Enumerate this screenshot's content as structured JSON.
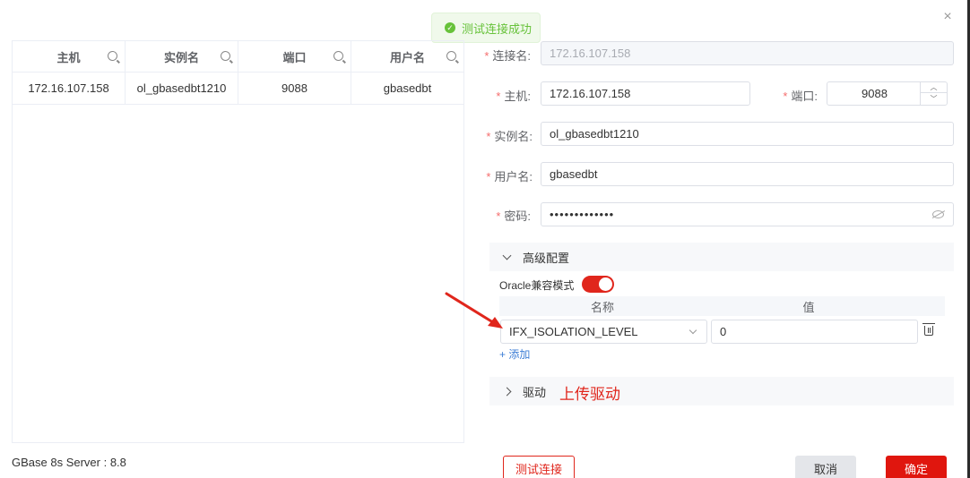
{
  "toast": {
    "message": "测试连接成功"
  },
  "table": {
    "columns": [
      "主机",
      "实例名",
      "端口",
      "用户名"
    ],
    "rows": [
      [
        "172.16.107.158",
        "ol_gbasedbt1210",
        "9088",
        "gbasedbt"
      ]
    ]
  },
  "footer": {
    "version": "GBase 8s Server : 8.8"
  },
  "form": {
    "conn_name_label": "连接名:",
    "conn_name_value": "172.16.107.158",
    "host_label": "主机:",
    "host_value": "172.16.107.158",
    "port_label": "端口:",
    "port_value": "9088",
    "instance_label": "实例名:",
    "instance_value": "ol_gbasedbt1210",
    "user_label": "用户名:",
    "user_value": "gbasedbt",
    "password_label": "密码:",
    "password_value": "•••••••••••••"
  },
  "advanced": {
    "title": "高级配置",
    "oracle_mode_label": "Oracle兼容模式",
    "oracle_mode_on": true,
    "col_name": "名称",
    "col_value": "值",
    "param_name": "IFX_ISOLATION_LEVEL",
    "param_value": "0",
    "add_label": "+ 添加"
  },
  "driver": {
    "title": "驱动",
    "annotation": "上传驱动"
  },
  "buttons": {
    "test": "测试连接",
    "cancel": "取消",
    "ok": "确定"
  },
  "colors": {
    "accent": "#e0160e",
    "success": "#67c23a"
  },
  "icons": [
    "close-icon",
    "check-circle-icon",
    "search-icon",
    "eye-off-icon",
    "trash-icon",
    "chevron-down-icon",
    "chevron-right-icon"
  ]
}
